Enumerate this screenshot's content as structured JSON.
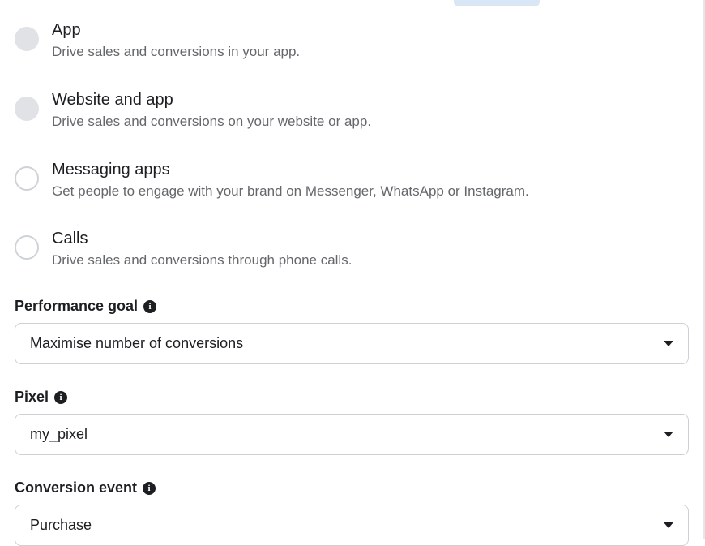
{
  "options": [
    {
      "title": "App",
      "desc": "Drive sales and conversions in your app."
    },
    {
      "title": "Website and app",
      "desc": "Drive sales and conversions on your website or app."
    },
    {
      "title": "Messaging apps",
      "desc": "Get people to engage with your brand on Messenger, WhatsApp or Instagram."
    },
    {
      "title": "Calls",
      "desc": "Drive sales and conversions through phone calls."
    }
  ],
  "fields": {
    "performance_goal": {
      "label": "Performance goal",
      "value": "Maximise number of conversions"
    },
    "pixel": {
      "label": "Pixel",
      "value": "my_pixel"
    },
    "conversion_event": {
      "label": "Conversion event",
      "value": "Purchase"
    }
  }
}
